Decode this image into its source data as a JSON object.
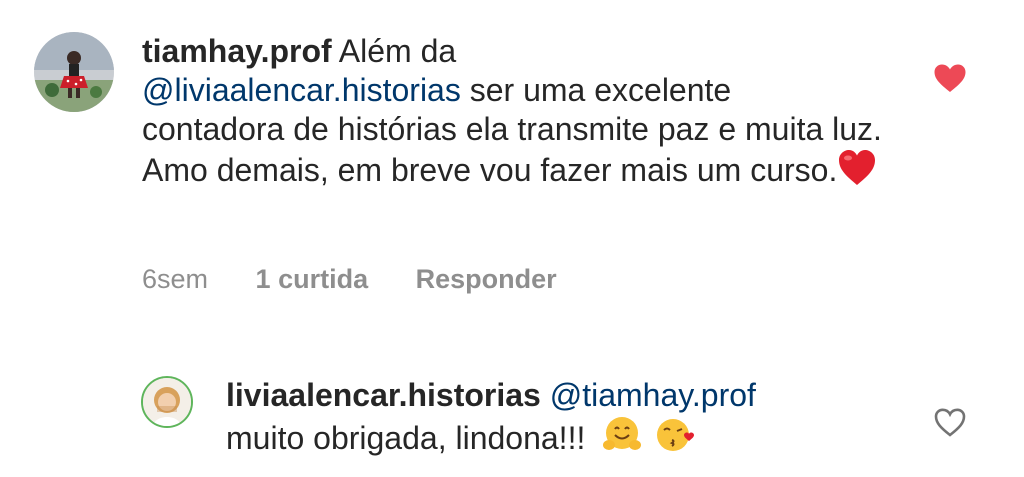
{
  "comment": {
    "username": "tiamhay.prof",
    "text_before_mention": "Além da",
    "mention": "@liviaalencar.historias",
    "text_after_mention": " ser uma excelente contadora de histórias ela transmite paz e muita luz. Amo demais, em breve vou fazer mais um curso.",
    "emoji": "red-heart",
    "time": "6sem",
    "likes": "1 curtida",
    "reply": "Responder",
    "liked": true,
    "like_color": "#ed4956"
  },
  "reply": {
    "username": "liviaalencar.historias",
    "mention": "@tiamhay.prof",
    "text": "muito obrigada, lindona!!!",
    "emojis": [
      "hugging-face",
      "kissing-face"
    ],
    "liked": false
  }
}
